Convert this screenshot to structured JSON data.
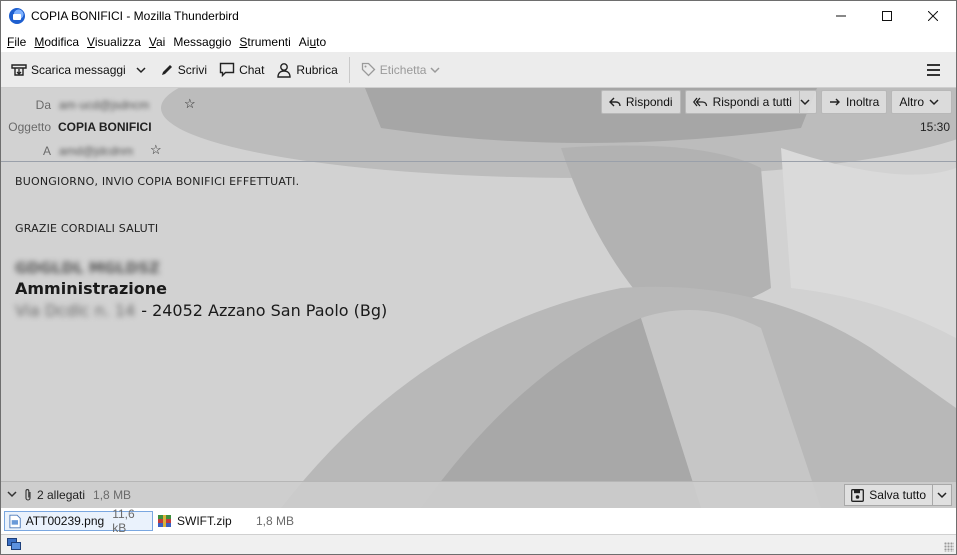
{
  "window": {
    "title": "COPIA BONIFICI - Mozilla Thunderbird",
    "controls": [
      "minimize",
      "maximize",
      "close"
    ]
  },
  "menubar": {
    "items": [
      {
        "label": "File",
        "underline": "F",
        "rest": "ile"
      },
      {
        "label": "Modifica",
        "underline": "M",
        "rest": "odifica"
      },
      {
        "label": "Visualizza",
        "underline": "V",
        "rest": "isualizza"
      },
      {
        "label": "Vai",
        "underline": "V",
        "rest": "ai"
      },
      {
        "label": "Messaggio",
        "pre": "Messa",
        "underline": "g",
        "rest": "gio"
      },
      {
        "label": "Strumenti",
        "underline": "S",
        "rest": "trumenti"
      },
      {
        "label": "Aiuto",
        "pre": "Ai",
        "underline": "u",
        "rest": "to"
      }
    ]
  },
  "toolbar": {
    "get_messages": "Scarica messaggi",
    "write": "Scrivi",
    "chat": "Chat",
    "address_book": "Rubrica",
    "tag": "Etichetta"
  },
  "header": {
    "from_label": "Da",
    "from_value": "am·ucd@jsdncm",
    "subject_label": "Oggetto",
    "subject_value": "COPIA BONIFICI",
    "to_label": "A",
    "to_value": "amd@jdcdnm",
    "time": "15:30",
    "actions": {
      "reply": "Rispondi",
      "reply_all": "Rispondi a tutti",
      "forward": "Inoltra",
      "other": "Altro"
    }
  },
  "body": {
    "line1": "BUONGIORNO, INVIO COPIA BONIFICI EFFETTUATI.",
    "line2": "GRAZIE CORDIALI SALUTI",
    "sig_name": "GDGLDL MGLDSZ",
    "sig_title": "Amministrazione",
    "sig_addr_hidden": "Via Dcdlc n. 14",
    "sig_addr": "- 24052 Azzano San Paolo (Bg)"
  },
  "attachments": {
    "count_label": "2 allegati",
    "total_size": "1,8 MB",
    "save_all": "Salva tutto",
    "items": [
      {
        "name": "ATT00239.png",
        "size": "11,6 kB",
        "icon": "image-file-icon"
      },
      {
        "name": "SWIFT.zip",
        "size": "1,8 MB",
        "icon": "zip-archive-icon"
      }
    ]
  },
  "colors": {
    "accent": "#1e5fcf",
    "background_art": "#d4d4d4",
    "toolbar": "#ececec"
  }
}
